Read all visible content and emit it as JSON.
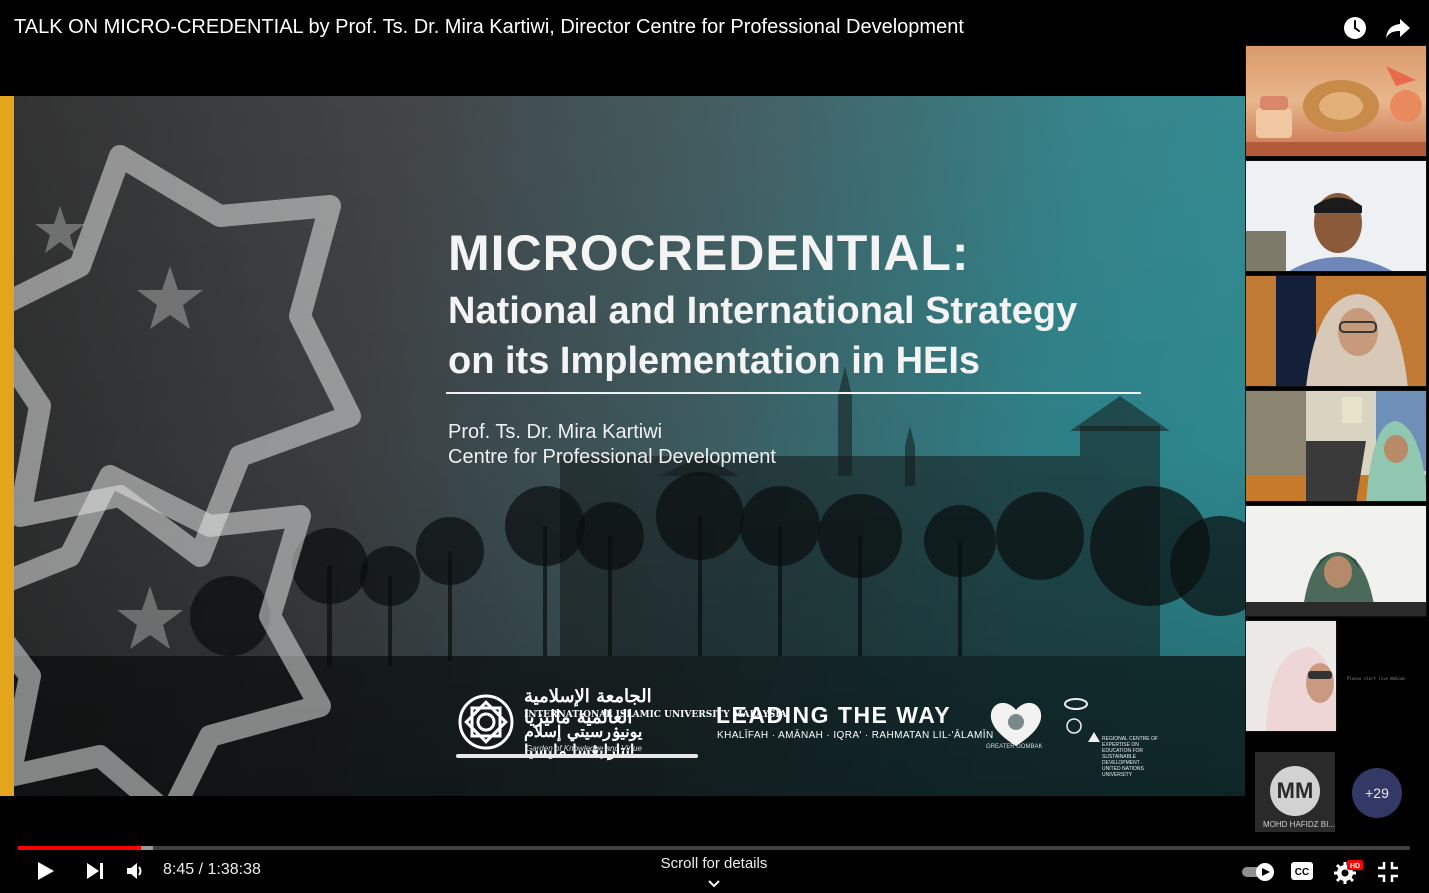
{
  "video": {
    "title": "TALK ON MICRO-CREDENTIAL by Prof. Ts. Dr. Mira Kartiwi, Director Centre for Professional Development"
  },
  "top_actions": [
    {
      "icon": "clock-icon",
      "label": "Watch later"
    },
    {
      "icon": "share-icon",
      "label": "Share"
    }
  ],
  "slide": {
    "title": "MICROCREDENTIAL:",
    "subtitle_line1": "National and International Strategy",
    "subtitle_line2": "on its Implementation in HEIs",
    "presenter_name": "Prof. Ts. Dr. Mira Kartiwi",
    "presenter_org": "Centre for Professional Development",
    "logos": {
      "iium_arabic": "الجامعة الإسلامية العالمية ماليزيا",
      "iium_english": "INTERNATIONAL ISLAMIC UNIVERSITY MALAYSIA",
      "iium_malay_jawi": "يونيۏرسيتي إسلام انتارابڠسا مليسيا",
      "iium_motto": "Garden of Knowledge and Virtue",
      "leading": "LEADING THE WAY",
      "leading_sub": "KHALĪFAH · AMĀNAH · IQRA' · RAHMATAN LIL-'ĀLAMĪN",
      "gombak": "GREATER GOMBAK",
      "un_text": "REGIONAL CENTRE OF EXPERTISE ON EDUCATION FOR SUSTAINABLE DEVELOPMENT · UNITED NATIONS UNIVERSITY"
    },
    "colors": {
      "accent": "#e3a51b",
      "teal": "#2c8a90"
    }
  },
  "participants": {
    "avatar_initials": "MM",
    "avatar_name": "MOHD HAFIDZ BI...",
    "more_count": "+29",
    "tiny_note": "Please start live Webcam"
  },
  "player": {
    "progress_fraction": 0.0885,
    "buffer_fraction": 0.097,
    "time_display": "8:45 / 1:38:38",
    "scroll_hint": "Scroll for details",
    "autoplay_on": true,
    "quality_badge": "HD",
    "accent_color": "#ff0000"
  }
}
